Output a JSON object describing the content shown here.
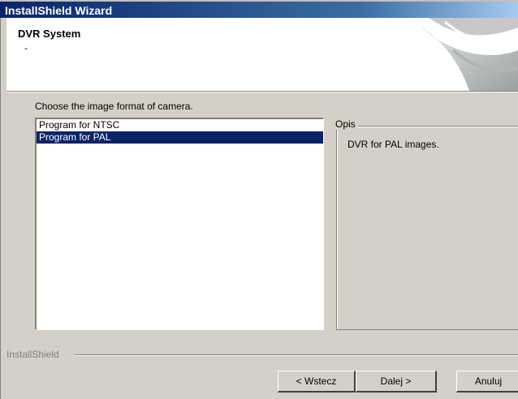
{
  "window": {
    "title": "InstallShield Wizard"
  },
  "header": {
    "title": "DVR System",
    "subtitle": "-"
  },
  "prompt": "Choose the image format of camera.",
  "list": {
    "items": [
      {
        "label": "Program for NTSC",
        "selected": false
      },
      {
        "label": "Program for PAL",
        "selected": true
      }
    ]
  },
  "description": {
    "legend": "Opis",
    "text": "DVR for PAL images."
  },
  "footer": {
    "brand": "InstallShield"
  },
  "buttons": {
    "back": "< Wstecz",
    "next": "Dalej >",
    "cancel": "Anuluj"
  },
  "colors": {
    "selection": "#0a246a",
    "face": "#d4d0c8"
  }
}
